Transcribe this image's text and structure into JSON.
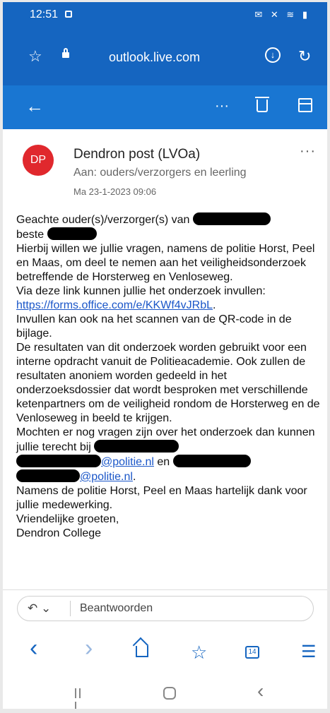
{
  "status_bar": {
    "time": "12:51",
    "right_icons": "✉ ✕ ≋ ▮"
  },
  "browser": {
    "url": "outlook.live.com",
    "star_icon": "☆",
    "download_icon": "↓",
    "refresh_icon": "↻"
  },
  "app_bar": {
    "back_icon": "←",
    "more_icon": "···"
  },
  "email": {
    "avatar_initials": "DP",
    "sender": "Dendron post (LVOa)",
    "recipient": "Aan: ouders/verzorgers en leerling",
    "date": "Ma 23-1-2023 09:06",
    "more_icon": "···",
    "lines": {
      "l1": "Geachte ouder(s)/verzorger(s) van",
      "l2": "beste",
      "l3": "Hierbij willen we jullie vragen, namens de politie Horst, Peel en Maas, om deel te nemen aan het veiligheidsonderzoek betreffende de Horsterweg en Venloseweg.",
      "l4": "Via deze link kunnen jullie het onderzoek invullen:",
      "link": "https://forms.office.com/e/KKWf4vJRbL",
      "l5": "Invullen kan ook na het scannen van de QR-code in de bijlage.",
      "l6": "De resultaten van dit onderzoek worden gebruikt voor een interne opdracht vanuit de Politieacademie. Ook zullen de resultaten anoniem worden gedeeld in het onderzoeksdossier dat wordt besproken met verschillende ketenpartners om de veiligheid rondom de Horsterweg en de Venloseweg in beeld te krijgen.",
      "l7": "Mochten er nog vragen zijn over het onderzoek dan kunnen jullie terecht bij",
      "email1": "@politie.nl",
      "en": "en",
      "email2": "@politie.nl",
      "l8": "Namens de politie Horst, Peel en Maas hartelijk dank voor jullie medewerking.",
      "l9": "Vriendelijke groeten,",
      "l10": "Dendron College"
    }
  },
  "reply": {
    "label": "Beantwoorden",
    "icon": "↶ ⌄"
  },
  "bottom_bar": {
    "back_icon": "‹",
    "forward_icon": "›",
    "tabs_count": "14",
    "menu_icon": "☰"
  },
  "nav_bar": {
    "back_icon": "‹"
  }
}
